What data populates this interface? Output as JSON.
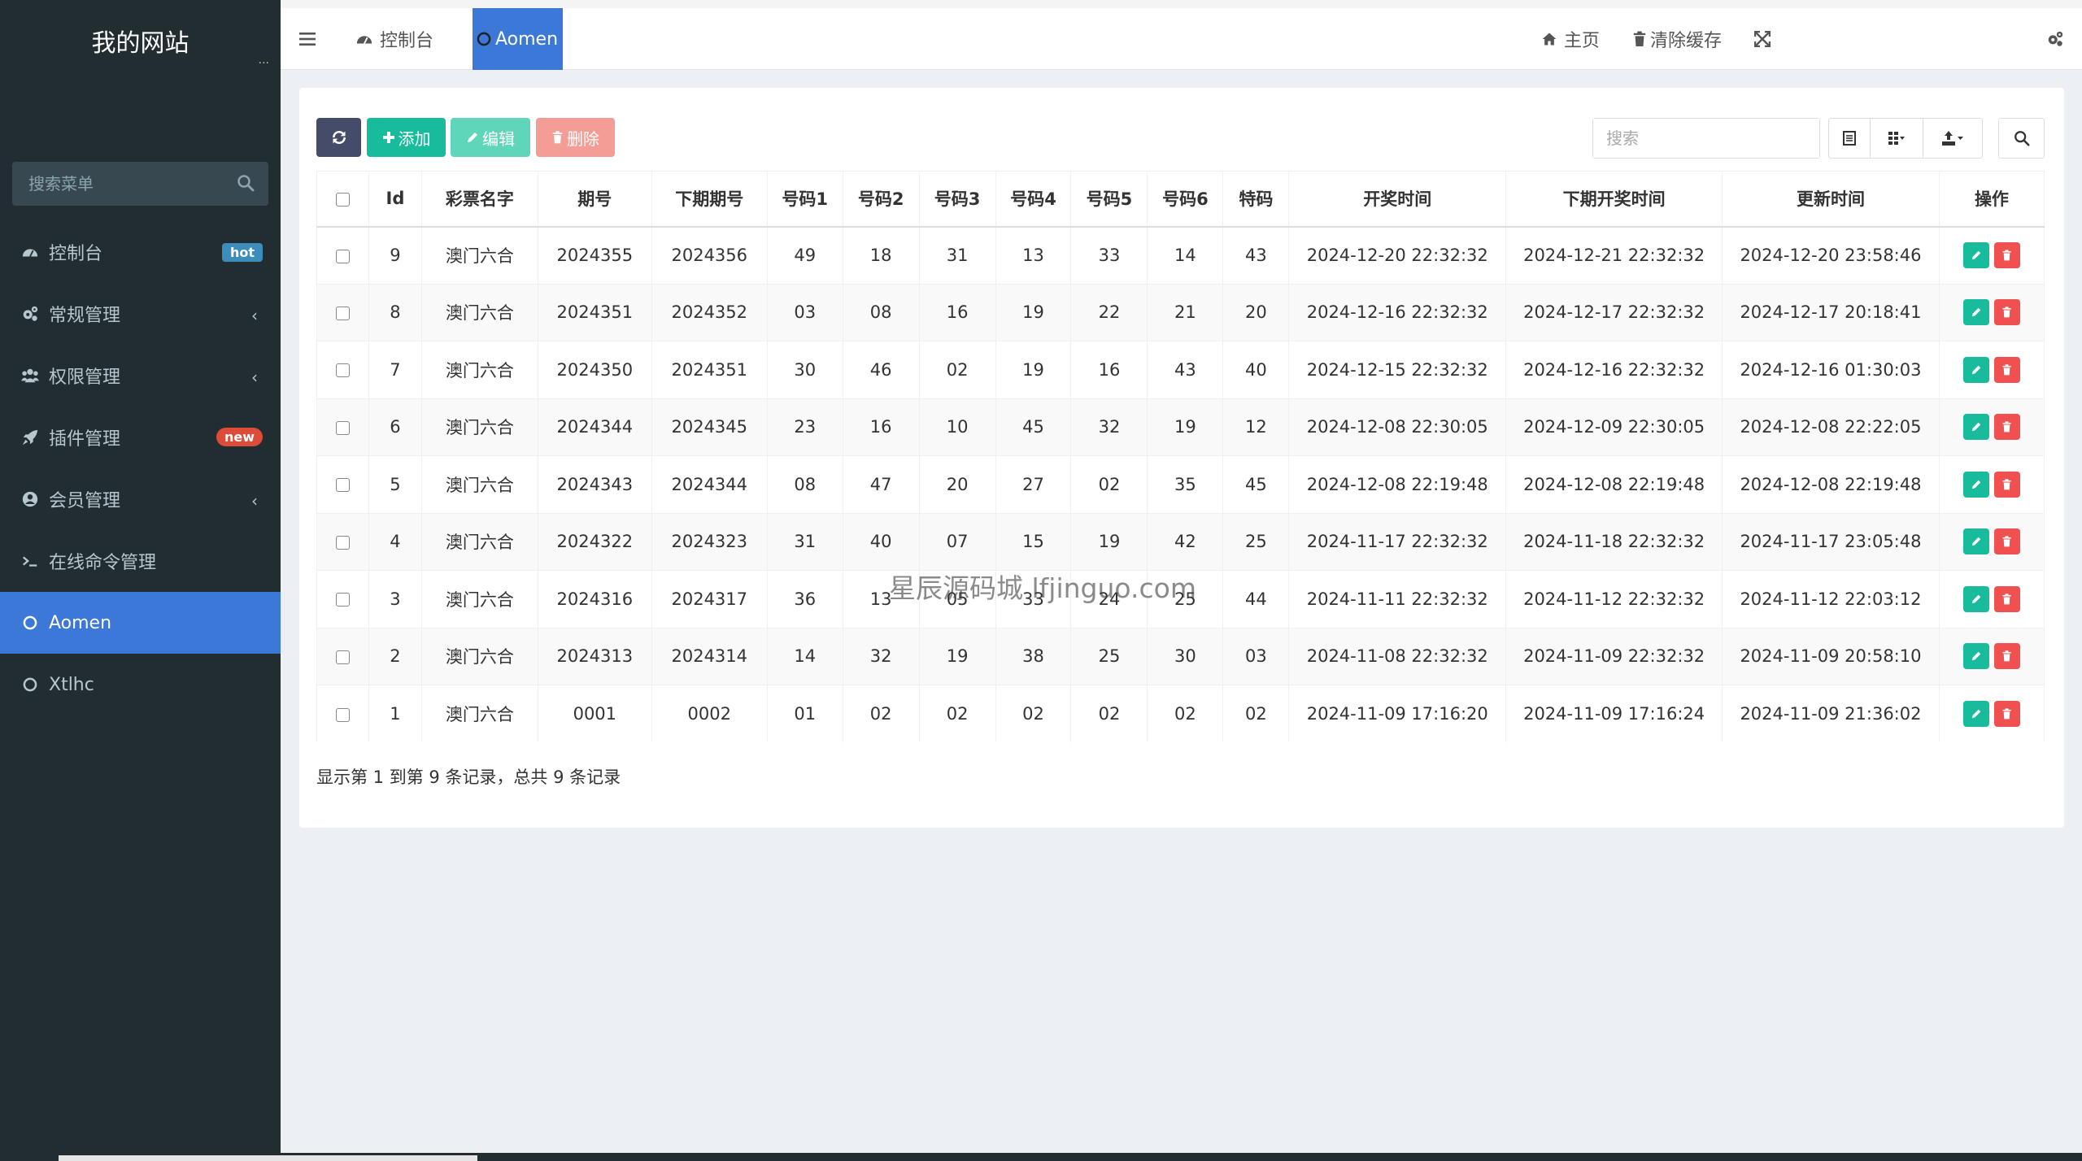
{
  "brand": {
    "title": "我的网站",
    "dots": "..."
  },
  "sidebar": {
    "search_placeholder": "搜索菜单",
    "items": [
      {
        "label": "控制台",
        "icon": "dashboard-icon",
        "badge": "hot"
      },
      {
        "label": "常规管理",
        "icon": "cogs-icon",
        "chevron": "‹"
      },
      {
        "label": "权限管理",
        "icon": "users-icon",
        "chevron": "‹"
      },
      {
        "label": "插件管理",
        "icon": "rocket-icon",
        "badge": "new"
      },
      {
        "label": "会员管理",
        "icon": "user-circle-icon",
        "chevron": "‹"
      },
      {
        "label": "在线命令管理",
        "icon": "terminal-icon"
      },
      {
        "label": "Aomen",
        "icon": "circle-icon",
        "active": true
      },
      {
        "label": "Xtlhc",
        "icon": "circle-icon"
      }
    ]
  },
  "topbar": {
    "tabs": [
      {
        "label": "控制台",
        "icon": "dashboard-icon"
      },
      {
        "label": "Aomen",
        "icon": "circle-icon",
        "active": true
      }
    ],
    "home_label": "主页",
    "clear_cache_label": "清除缓存"
  },
  "toolbar": {
    "add_label": "添加",
    "edit_label": "编辑",
    "delete_label": "删除",
    "search_placeholder": "搜索"
  },
  "colors": {
    "sidebar_bg": "#222d32",
    "active": "#3c78d8",
    "refresh": "#444c69",
    "add": "#18bc9c",
    "edit": "#5fd6b9",
    "delete": "#f49d96",
    "danger": "#f05050"
  },
  "table": {
    "columns": [
      "Id",
      "彩票名字",
      "期号",
      "下期期号",
      "号码1",
      "号码2",
      "号码3",
      "号码4",
      "号码5",
      "号码6",
      "特码",
      "开奖时间",
      "下期开奖时间",
      "更新时间",
      "操作"
    ],
    "rows": [
      [
        "9",
        "澳门六合",
        "2024355",
        "2024356",
        "49",
        "18",
        "31",
        "13",
        "33",
        "14",
        "43",
        "2024-12-20 22:32:32",
        "2024-12-21 22:32:32",
        "2024-12-20 23:58:46"
      ],
      [
        "8",
        "澳门六合",
        "2024351",
        "2024352",
        "03",
        "08",
        "16",
        "19",
        "22",
        "21",
        "20",
        "2024-12-16 22:32:32",
        "2024-12-17 22:32:32",
        "2024-12-17 20:18:41"
      ],
      [
        "7",
        "澳门六合",
        "2024350",
        "2024351",
        "30",
        "46",
        "02",
        "19",
        "16",
        "43",
        "40",
        "2024-12-15 22:32:32",
        "2024-12-16 22:32:32",
        "2024-12-16 01:30:03"
      ],
      [
        "6",
        "澳门六合",
        "2024344",
        "2024345",
        "23",
        "16",
        "10",
        "45",
        "32",
        "19",
        "12",
        "2024-12-08 22:30:05",
        "2024-12-09 22:30:05",
        "2024-12-08 22:22:05"
      ],
      [
        "5",
        "澳门六合",
        "2024343",
        "2024344",
        "08",
        "47",
        "20",
        "27",
        "02",
        "35",
        "45",
        "2024-12-08 22:19:48",
        "2024-12-08 22:19:48",
        "2024-12-08 22:19:48"
      ],
      [
        "4",
        "澳门六合",
        "2024322",
        "2024323",
        "31",
        "40",
        "07",
        "15",
        "19",
        "42",
        "25",
        "2024-11-17 22:32:32",
        "2024-11-18 22:32:32",
        "2024-11-17 23:05:48"
      ],
      [
        "3",
        "澳门六合",
        "2024316",
        "2024317",
        "36",
        "13",
        "05",
        "33",
        "24",
        "25",
        "44",
        "2024-11-11 22:32:32",
        "2024-11-12 22:32:32",
        "2024-11-12 22:03:12"
      ],
      [
        "2",
        "澳门六合",
        "2024313",
        "2024314",
        "14",
        "32",
        "19",
        "38",
        "25",
        "30",
        "03",
        "2024-11-08 22:32:32",
        "2024-11-09 22:32:32",
        "2024-11-09 20:58:10"
      ],
      [
        "1",
        "澳门六合",
        "0001",
        "0002",
        "01",
        "02",
        "02",
        "02",
        "02",
        "02",
        "02",
        "2024-11-09 17:16:20",
        "2024-11-09 17:16:24",
        "2024-11-09 21:36:02"
      ]
    ]
  },
  "footer": {
    "summary": "显示第 1 到第 9 条记录，总共 9 条记录"
  },
  "watermark": "星辰源码城 lfjinguo.com"
}
